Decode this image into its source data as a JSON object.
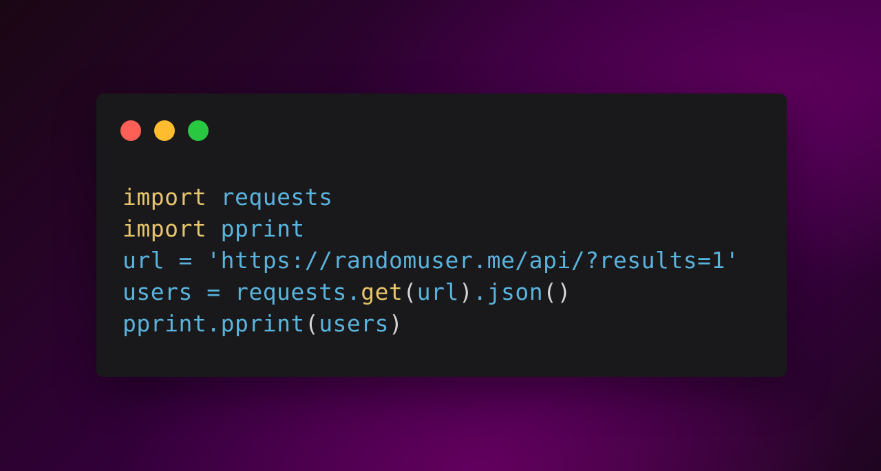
{
  "colors": {
    "window_bg": "#19191b",
    "close_dot": "#ff5f57",
    "minimize_dot": "#febc2e",
    "maximize_dot": "#28c840",
    "keyword": "#e8c56a",
    "identifier": "#5ab3dc",
    "punctuation": "#d4d4d4"
  },
  "window_controls": [
    {
      "name": "close",
      "icon": "red-circle",
      "color": "#ff5f57"
    },
    {
      "name": "minimize",
      "icon": "yellow-circle",
      "color": "#febc2e"
    },
    {
      "name": "maximize",
      "icon": "green-circle",
      "color": "#28c840"
    }
  ],
  "code": {
    "language": "python",
    "lines": [
      [
        {
          "text": "import",
          "type": "keyword"
        },
        {
          "text": " ",
          "type": "space"
        },
        {
          "text": "requests",
          "type": "name"
        }
      ],
      [
        {
          "text": "import",
          "type": "keyword"
        },
        {
          "text": " ",
          "type": "space"
        },
        {
          "text": "pprint",
          "type": "name"
        }
      ],
      [
        {
          "text": "url",
          "type": "name"
        },
        {
          "text": " = ",
          "type": "op"
        },
        {
          "text": "'https://randomuser.me/api/?results=1'",
          "type": "string"
        }
      ],
      [
        {
          "text": "users",
          "type": "name"
        },
        {
          "text": " = ",
          "type": "op"
        },
        {
          "text": "requests",
          "type": "name"
        },
        {
          "text": ".",
          "type": "op"
        },
        {
          "text": "get",
          "type": "func"
        },
        {
          "text": "(",
          "type": "punct"
        },
        {
          "text": "url",
          "type": "name"
        },
        {
          "text": ")",
          "type": "punct"
        },
        {
          "text": ".json",
          "type": "name"
        },
        {
          "text": "()",
          "type": "punct"
        }
      ],
      [
        {
          "text": "pprint",
          "type": "name"
        },
        {
          "text": ".",
          "type": "op"
        },
        {
          "text": "pprint",
          "type": "name"
        },
        {
          "text": "(",
          "type": "punct"
        },
        {
          "text": "users",
          "type": "name"
        },
        {
          "text": ")",
          "type": "punct"
        }
      ]
    ]
  }
}
